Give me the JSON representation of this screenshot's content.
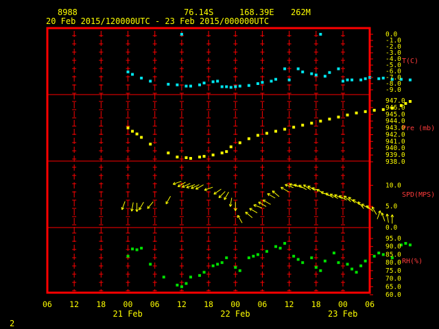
{
  "header": {
    "station_id": "8988",
    "latitude": "76.14S",
    "longitude": "168.39E",
    "elevation": "262M",
    "time_range": "20 Feb 2015/120000UTC - 23 Feb 2015/000000UTC"
  },
  "page_number": "2",
  "colors": {
    "background": "#000000",
    "frame": "#ff0000",
    "text": "#ffff00",
    "labels": "#ff3b3b",
    "temperature": "#00e5ee",
    "pressure": "#ffff00",
    "wind": "#ffff00",
    "humidity": "#00e000"
  },
  "chart_data": [
    {
      "type": "scatter",
      "id": "temperature",
      "ylabel": "T(C)",
      "ylim": [
        -9.0,
        0.0
      ],
      "yticks": [
        "0.0",
        "-1.0",
        "-2.0",
        "-3.0",
        "-4.0",
        "-5.0",
        "-6.0",
        "-7.0",
        "-8.0",
        "-9.0"
      ],
      "x_hours": [
        15,
        16,
        18,
        20,
        24,
        26,
        28,
        29,
        31,
        32,
        34,
        35,
        36,
        37,
        38,
        39,
        40,
        42,
        44,
        45,
        47,
        48,
        50,
        51,
        53,
        54,
        56,
        57,
        59,
        60,
        62,
        63,
        64,
        65,
        67,
        68,
        69,
        71,
        72,
        74,
        76,
        78
      ],
      "values": [
        -6.1,
        -6.5,
        -7.1,
        -7.6,
        -8.1,
        -8.2,
        -8.4,
        -8.4,
        -8.2,
        -7.9,
        -7.7,
        -7.6,
        -8.5,
        -8.5,
        -8.6,
        -8.5,
        -8.4,
        -8.3,
        -8.0,
        -7.8,
        -7.6,
        -7.3,
        -5.6,
        -7.4,
        -5.6,
        -6.1,
        -6.4,
        -6.6,
        -6.8,
        -6.2,
        -5.6,
        -7.6,
        -7.4,
        -7.4,
        -7.4,
        -7.2,
        -7.0,
        -7.2,
        -7.1,
        -7.3,
        -7.3,
        -7.4
      ],
      "outliers": [
        {
          "x_hours": 27,
          "value": 0.0
        },
        {
          "x_hours": 58,
          "value": 0.0
        }
      ]
    },
    {
      "type": "scatter",
      "id": "pressure",
      "ylabel": "Pre (mb)",
      "ylim": [
        938.0,
        947.0
      ],
      "yticks": [
        "947.0",
        "946.0",
        "945.0",
        "944.0",
        "943.0",
        "942.0",
        "941.0",
        "940.0",
        "939.0",
        "938.0"
      ],
      "x_hours": [
        15,
        16,
        17,
        18,
        20,
        24,
        26,
        28,
        29,
        31,
        32,
        34,
        36,
        37,
        38,
        40,
        42,
        44,
        46,
        48,
        50,
        52,
        54,
        56,
        58,
        60,
        62,
        64,
        66,
        68,
        70,
        72,
        74,
        76,
        77,
        78
      ],
      "values": [
        943.0,
        942.5,
        942.1,
        941.6,
        940.6,
        939.3,
        938.7,
        938.6,
        938.5,
        938.7,
        938.8,
        939.0,
        939.3,
        939.5,
        940.2,
        940.8,
        941.4,
        941.9,
        942.2,
        942.5,
        942.8,
        943.1,
        943.4,
        943.7,
        944.0,
        944.3,
        944.6,
        944.9,
        945.2,
        945.4,
        945.6,
        945.7,
        945.9,
        946.3,
        946.6,
        946.9
      ]
    },
    {
      "type": "scatter",
      "id": "wind",
      "ylabel": "SPD(MPS)",
      "ylim": [
        0.0,
        12.0
      ],
      "yticks": [
        "10.0",
        "5.0",
        "0.0"
      ],
      "x_hours": [
        14,
        16,
        17,
        18,
        20,
        24,
        26,
        27,
        28,
        29,
        30,
        31,
        33,
        35,
        36,
        37,
        38,
        39,
        40,
        42,
        43,
        44,
        45,
        46,
        47,
        48,
        50,
        51,
        52,
        53,
        54,
        55,
        56,
        57,
        58,
        59,
        60,
        61,
        62,
        63,
        64,
        65,
        66,
        67,
        68,
        69,
        70,
        71,
        72,
        73,
        74
      ],
      "values": [
        5.2,
        4.9,
        4.8,
        5.1,
        5.3,
        6.5,
        10.6,
        10.2,
        10.0,
        9.8,
        9.7,
        9.6,
        9.2,
        8.5,
        7.8,
        7.5,
        6.0,
        5.0,
        2.0,
        3.0,
        4.0,
        5.0,
        5.5,
        6.0,
        7.5,
        8.0,
        9.0,
        9.8,
        10.0,
        9.8,
        9.5,
        9.5,
        9.3,
        9.0,
        8.5,
        8.0,
        7.6,
        7.4,
        7.3,
        7.0,
        6.8,
        6.5,
        6.0,
        5.3,
        5.0,
        4.5,
        4.0,
        3.0,
        2.5,
        2.2,
        2.0
      ],
      "directions_deg": [
        250,
        260,
        270,
        240,
        230,
        240,
        200,
        210,
        205,
        200,
        205,
        210,
        200,
        215,
        225,
        240,
        260,
        270,
        120,
        140,
        150,
        160,
        150,
        150,
        150,
        140,
        150,
        160,
        165,
        160,
        150,
        145,
        150,
        160,
        150,
        155,
        150,
        150,
        155,
        150,
        140,
        140,
        145,
        130,
        150,
        140,
        120,
        70,
        110,
        100,
        90
      ]
    },
    {
      "type": "scatter",
      "id": "humidity",
      "ylabel": "RH(%)",
      "ylim": [
        60.0,
        95.0
      ],
      "yticks": [
        "95.0",
        "90.0",
        "85.0",
        "80.0",
        "75.0",
        "70.0",
        "65.0",
        "60.0"
      ],
      "x_hours": [
        15,
        16,
        17,
        18,
        20,
        23,
        26,
        27,
        28,
        29,
        31,
        32,
        34,
        35,
        36,
        37,
        39,
        40,
        42,
        43,
        44,
        46,
        48,
        49,
        50,
        52,
        53,
        54,
        56,
        57,
        58,
        59,
        61,
        62,
        64,
        65,
        66,
        67,
        68,
        70,
        71,
        72,
        74,
        76,
        77,
        78
      ],
      "values": [
        84.0,
        88.5,
        88.0,
        89.0,
        79.0,
        71.0,
        66.0,
        65.0,
        67.0,
        71.0,
        72.0,
        74.0,
        78.0,
        79.0,
        80.0,
        83.0,
        77.0,
        75.0,
        83.0,
        84.0,
        85.0,
        87.0,
        90.0,
        89.0,
        92.0,
        84.0,
        82.0,
        80.0,
        83.0,
        77.0,
        75.0,
        81.0,
        86.0,
        80.0,
        79.0,
        76.0,
        74.0,
        78.0,
        81.0,
        84.0,
        86.0,
        85.0,
        83.0,
        91.0,
        92.0,
        91.0
      ]
    }
  ],
  "x_axis": {
    "range_hours": [
      6,
      78
    ],
    "hour_labels": [
      "06",
      "12",
      "18",
      "00",
      "06",
      "12",
      "18",
      "00",
      "06",
      "12",
      "18",
      "00",
      "06"
    ],
    "hour_positions": [
      6,
      12,
      18,
      24,
      30,
      36,
      42,
      48,
      54,
      60,
      66,
      72,
      78
    ],
    "date_labels": [
      "21 Feb",
      "22 Feb",
      "23 Feb"
    ],
    "date_positions": [
      24,
      48,
      72
    ],
    "x_data_offset": 9
  }
}
